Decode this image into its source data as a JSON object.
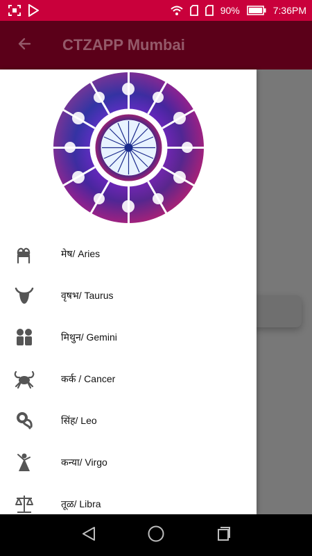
{
  "status_bar": {
    "battery_percent": "90%",
    "time": "7:36PM",
    "icons": [
      "screenshot-icon",
      "play-store-icon",
      "wifi-icon",
      "sim-card-icon",
      "sim-card-icon",
      "battery-icon"
    ]
  },
  "app_bar": {
    "title": "CTZAPP Mumbai",
    "back_icon": "arrow-back-icon"
  },
  "drawer": {
    "header_image": "zodiac-wheel",
    "items": [
      {
        "label": "मेष/ Aries",
        "icon": "aries-icon"
      },
      {
        "label": "वृषभ/ Taurus",
        "icon": "taurus-icon"
      },
      {
        "label": "मिथुन/ Gemini",
        "icon": "gemini-icon"
      },
      {
        "label": "कर्क / Cancer",
        "icon": "cancer-icon"
      },
      {
        "label": "सिंह/ Leo",
        "icon": "leo-icon"
      },
      {
        "label": "कन्या/ Virgo",
        "icon": "virgo-icon"
      },
      {
        "label": "तूळ/ Libra",
        "icon": "libra-icon"
      }
    ]
  },
  "nav_bar": {
    "buttons": [
      "back-triangle-icon",
      "home-circle-icon",
      "recents-square-icon"
    ]
  },
  "colors": {
    "status_bar": "#c9003b",
    "app_bar": "#5b0019",
    "scrim": "#787878",
    "icon_gray": "#555555"
  }
}
